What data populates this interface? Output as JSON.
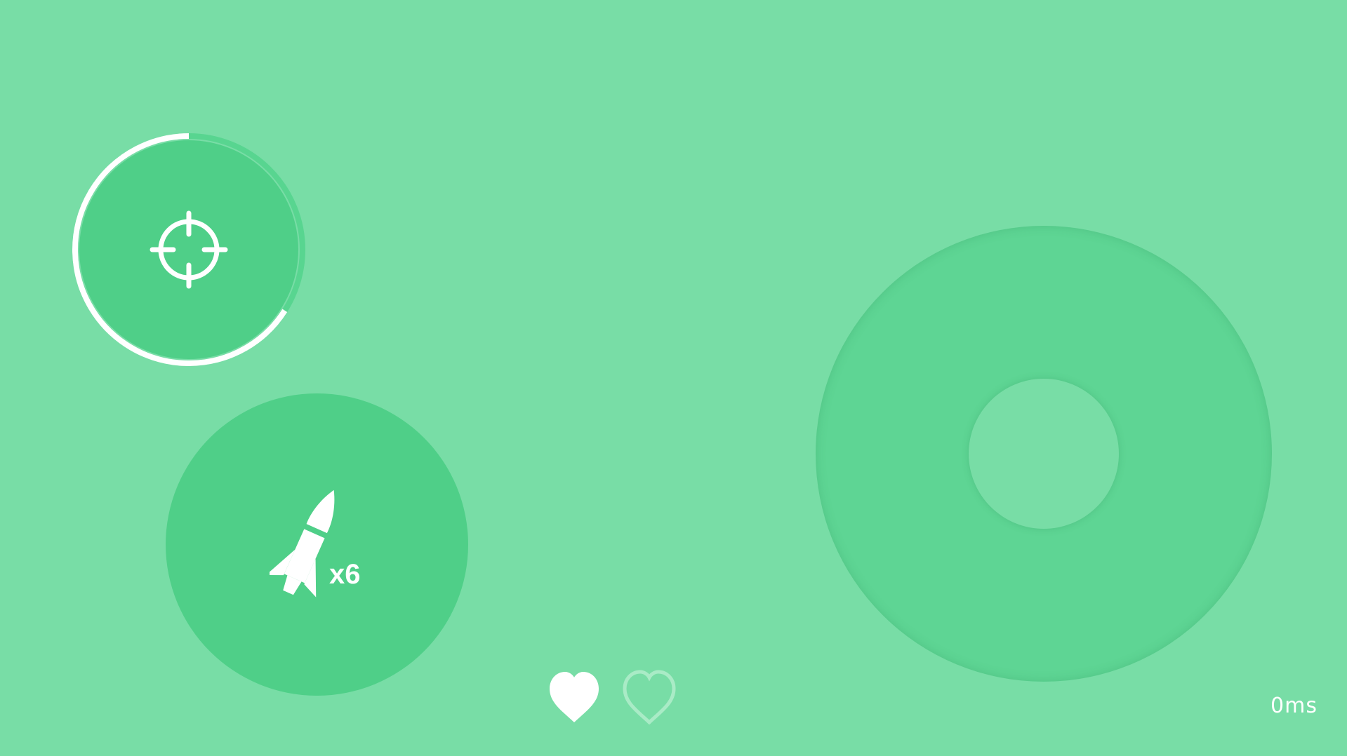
{
  "hud": {
    "aim_button": {
      "icon": "crosshair-icon",
      "cooldown_progress": 0.66
    },
    "rocket_button": {
      "icon": "rocket-icon",
      "count_label": "x6"
    },
    "joystick": {
      "base": "joystick-base",
      "knob": "joystick-knob"
    },
    "lives": {
      "total": 2,
      "remaining": 1,
      "icons": [
        "heart-filled-icon",
        "heart-outline-icon"
      ]
    },
    "ping_label": "0ms"
  },
  "colors": {
    "background": "#78dda6",
    "button_fill": "#4fcf88",
    "joystick_fill": "#5ed594",
    "foreground": "#ffffff"
  }
}
